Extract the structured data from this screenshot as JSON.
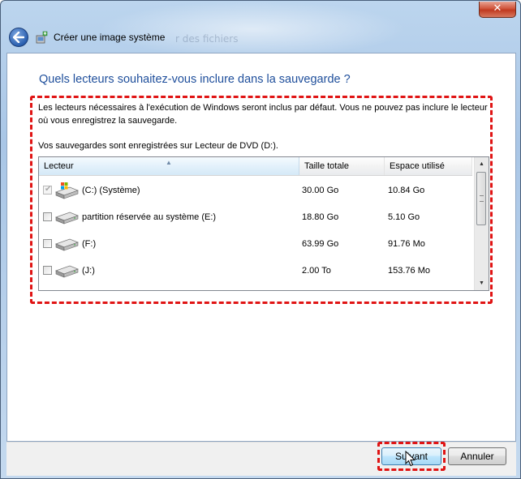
{
  "window": {
    "title": "Créer une image système",
    "background_text": "r des fichiers",
    "close_icon": "close-icon"
  },
  "heading": "Quels lecteurs souhaitez-vous inclure dans la sauvegarde ?",
  "description": "Les lecteurs nécessaires à l'exécution de Windows seront inclus par défaut. Vous ne pouvez pas inclure le lecteur où vous enregistrez la sauvegarde.",
  "saved_to": "Vos sauvegardes sont enregistrées sur Lecteur de DVD (D:).",
  "table": {
    "columns": [
      "Lecteur",
      "Taille totale",
      "Espace utilisé"
    ],
    "rows": [
      {
        "name": "(C:) (Système)",
        "total": "30.00 Go",
        "used": "10.84 Go",
        "checked": true,
        "disabled": true,
        "icon": "windows-drive-icon"
      },
      {
        "name": "partition réservée au système (E:)",
        "total": "18.80 Go",
        "used": "5.10 Go",
        "checked": false,
        "disabled": false,
        "icon": "hard-drive-icon"
      },
      {
        "name": "(F:)",
        "total": "63.99 Go",
        "used": "91.76 Mo",
        "checked": false,
        "disabled": false,
        "icon": "hard-drive-icon"
      },
      {
        "name": "(J:)",
        "total": "2.00 To",
        "used": "153.76 Mo",
        "checked": false,
        "disabled": false,
        "icon": "hard-drive-icon"
      }
    ]
  },
  "buttons": {
    "next": "Suivant",
    "cancel": "Annuler"
  },
  "colors": {
    "heading": "#1e4e9b",
    "highlight": "#e01414",
    "close_button": "#c03a20"
  }
}
